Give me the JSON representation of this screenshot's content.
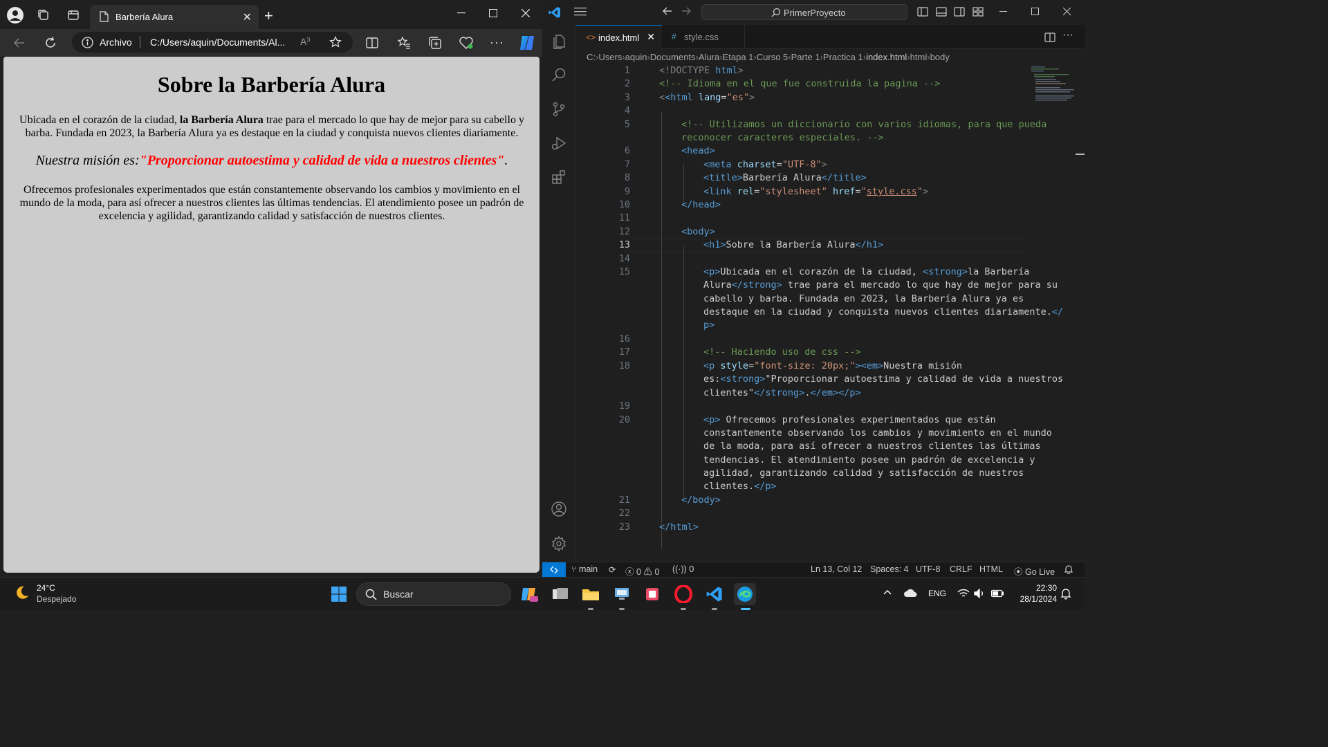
{
  "browser": {
    "tab_title": "Barbería Alura",
    "address_origin": "Archivo",
    "address_url": "C:/Users/aquin/Documents/Al...",
    "page": {
      "h1": "Sobre la Barbería Alura",
      "p1_before": "Ubicada en el corazón de la ciudad, ",
      "p1_strong": "la Barbería Alura",
      "p1_after": " trae para el mercado lo que hay de mejor para su cabello y barba. Fundada en 2023, la Barbería Alura ya es destaque en la ciudad y conquista nuevos clientes diariamente.",
      "p2_em": "Nuestra misión es:",
      "p2_strong": "\"Proporcionar autoestima y calidad de vida a nuestros clientes\"",
      "p2_after": ".",
      "p3": "Ofrecemos profesionales experimentados que están constantemente observando los cambios y movimiento en el mundo de la moda, para así ofrecer a nuestros clientes las últimas tendencias. El atendimiento posee un padrón de excelencia y agilidad, garantizando calidad y satisfacción de nuestros clientes."
    }
  },
  "vscode": {
    "search_text": "PrimerProyecto",
    "tabs": [
      {
        "icon": "<>",
        "label": "index.html"
      },
      {
        "icon": "#",
        "label": "style.css"
      }
    ],
    "breadcrumb": [
      "C:",
      "Users",
      "aquin",
      "Documents",
      "Alura",
      "Etapa 1",
      "Curso 5",
      "Parte 1",
      "Practica 1",
      "index.html",
      "html",
      "body"
    ],
    "line_numbers": [
      "1",
      "2",
      "3",
      "4",
      "5",
      "6",
      "7",
      "8",
      "9",
      "10",
      "11",
      "12",
      "13",
      "14",
      "15",
      "16",
      "17",
      "18",
      "19",
      "20",
      "21",
      "22",
      "23"
    ],
    "status": {
      "branch": "main",
      "errors": "0",
      "warnings": "0",
      "ports": "0",
      "cursor": "Ln 13, Col 12",
      "spaces": "Spaces: 4",
      "encoding": "UTF-8",
      "eol": "CRLF",
      "language": "HTML",
      "golive": "Go Live"
    },
    "code": {
      "l1_doctype": "<!DOCTYPE",
      "l1_html": " html",
      "l1_end": ">",
      "l2": "<!-- Idioma en el que fue construida la pagina -->",
      "l3_open": "<html",
      "l3_attr": " lang",
      "l3_eq": "=",
      "l3_val": "\"es\"",
      "l3_close": ">",
      "l5a": "<!-- Utilizamos un diccionario con varios idiomas, para que pueda",
      "l5b": "reconocer caracteres especiales. -->",
      "l6": "<head>",
      "l7_open": "<meta",
      "l7_attr": " charset",
      "l7_eq": "=",
      "l7_val": "\"UTF-8\"",
      "l7_close": ">",
      "l8_open": "<title>",
      "l8_text": "Barbería Alura",
      "l8_close": "</title>",
      "l9_open": "<link",
      "l9_attr1": " rel",
      "l9_eq1": "=",
      "l9_val1": "\"stylesheet\"",
      "l9_attr2": " href",
      "l9_eq2": "=",
      "l9_q1": "\"",
      "l9_href": "style.css",
      "l9_q2": "\"",
      "l9_close": ">",
      "l10": "</head>",
      "l12": "<body>",
      "l13_open": "<h1>",
      "l13_text": "Sobre la Barbería Alura",
      "l13_close": "</h1>",
      "l15a_open": "<p>",
      "l15a_text": "Ubicada en el corazón de la ciudad, ",
      "l15a_strong": "<strong>",
      "l15a_text2": "la Barbería",
      "l15b_text": "Alura",
      "l15b_strong_close": "</strong>",
      "l15b_text2": " trae para el mercado lo que hay de mejor para su",
      "l15c": "cabello y barba. Fundada en 2023, la Barbería Alura ya es",
      "l15d_text": "destaque en la ciudad y conquista nuevos clientes diariamente.",
      "l15d_close": "</",
      "l15e": "p>",
      "l17": "<!-- Haciendo uso de css -->",
      "l18a_open": "<p",
      "l18a_attr": " style",
      "l18a_eq": "=",
      "l18a_val": "\"font-size: 20px;\"",
      "l18a_gt": ">",
      "l18a_em": "<em>",
      "l18a_text": "Nuestra misión",
      "l18b_text": "es:",
      "l18b_strong": "<strong>",
      "l18b_text2": "\"Proporcionar autoestima y calidad de vida a nuestros",
      "l18c_text": "clientes\"",
      "l18c_strong_close": "</strong>",
      "l18c_dot": ".",
      "l18c_em_close": "</em>",
      "l18c_p_close": "</p>",
      "l20a_open": "<p>",
      "l20a_text": " Ofrecemos profesionales experimentados que están",
      "l20b": "constantemente observando los cambios y movimiento en el mundo",
      "l20c": "de la moda, para así ofrecer a nuestros clientes las últimas",
      "l20d": "tendencias. El atendimiento posee un padrón de excelencia y",
      "l20e": "agilidad, garantizando calidad y satisfacción de nuestros",
      "l20f_text": "clientes.",
      "l20f_close": "</p>",
      "l21": "</body>",
      "l23": "</html>"
    }
  },
  "taskbar": {
    "weather_temp": "24°C",
    "weather_desc": "Despejado",
    "search_placeholder": "Buscar",
    "lang": "ENG",
    "time": "22:30",
    "date": "28/1/2024"
  },
  "colors": {
    "vscode_accent": "#0078d4",
    "page_background": "#cccccc",
    "mission_red": "#ff0000"
  }
}
